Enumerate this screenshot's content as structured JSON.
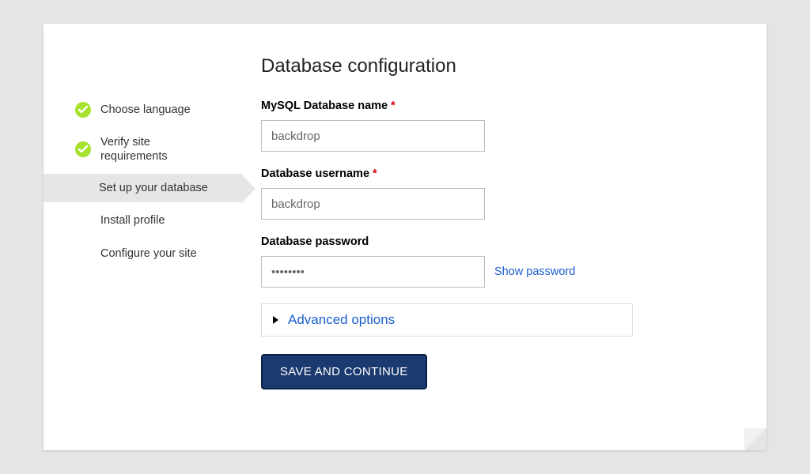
{
  "page_title": "Database configuration",
  "steps": [
    {
      "label": "Choose language",
      "state": "done"
    },
    {
      "label": "Verify site requirements",
      "state": "done"
    },
    {
      "label": "Set up your database",
      "state": "current"
    },
    {
      "label": "Install profile",
      "state": "future"
    },
    {
      "label": "Configure your site",
      "state": "future"
    }
  ],
  "form": {
    "db_name": {
      "label": "MySQL Database name",
      "required": true,
      "value": "backdrop"
    },
    "db_user": {
      "label": "Database username",
      "required": true,
      "value": "backdrop"
    },
    "db_pass": {
      "label": "Database password",
      "required": false,
      "value": "••••••••",
      "show_label": "Show password"
    },
    "advanced_label": "Advanced options",
    "submit_label": "SAVE AND CONTINUE"
  },
  "required_mark": "*"
}
